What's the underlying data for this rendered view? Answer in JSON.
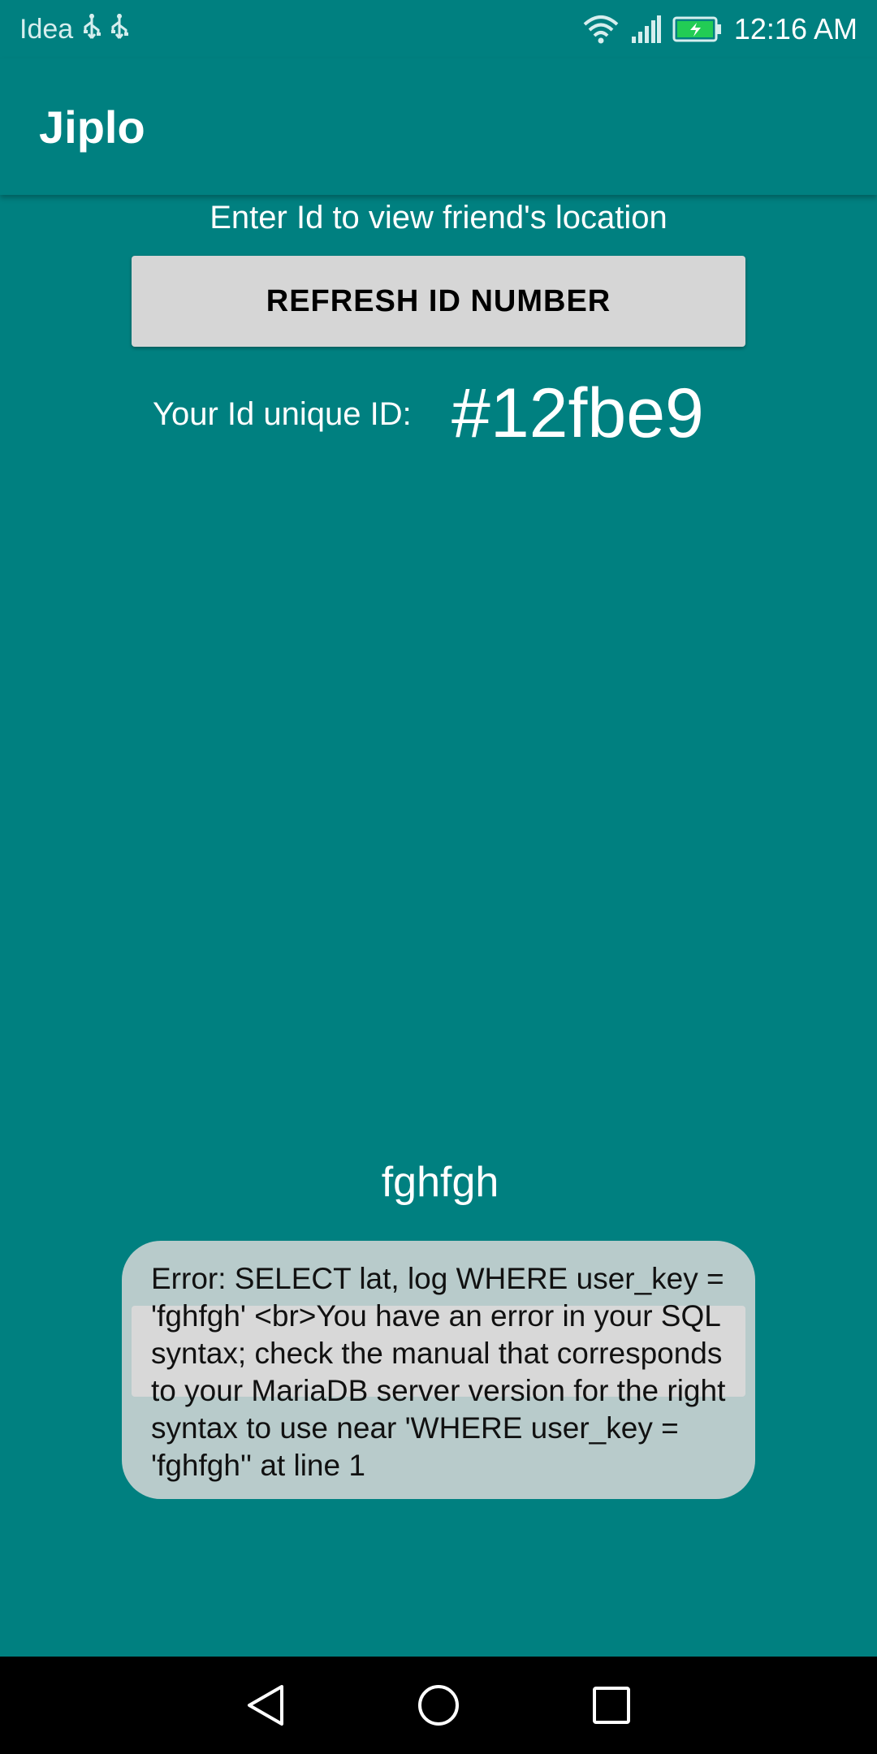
{
  "status_bar": {
    "carrier": "Idea",
    "time": "12:16 AM",
    "icons": [
      "usb-icon",
      "usb-icon",
      "wifi-icon",
      "signal-icon",
      "battery-charging-icon"
    ]
  },
  "app_bar": {
    "title": "Jiplo"
  },
  "main": {
    "instruction": "Enter Id to view friend's location",
    "refresh_button_label": "REFRESH ID NUMBER",
    "id_label": "Your Id unique ID:",
    "id_value": "#12fbe9",
    "friend_id_input_value": "fghfgh",
    "lookup_button_label": ""
  },
  "toast": {
    "message": "Error: SELECT lat, log  WHERE user_key = 'fghfgh'  <br>You have an error in your SQL syntax; check the manual that corresponds to your MariaDB server version for the right syntax to use near 'WHERE user_key = 'fghfgh'' at line 1"
  },
  "nav_bar": {
    "icons": [
      "back-icon",
      "home-icon",
      "recents-icon"
    ]
  },
  "colors": {
    "background": "#008080",
    "button": "#d6d6d6",
    "toast": "#d8d8d8"
  }
}
